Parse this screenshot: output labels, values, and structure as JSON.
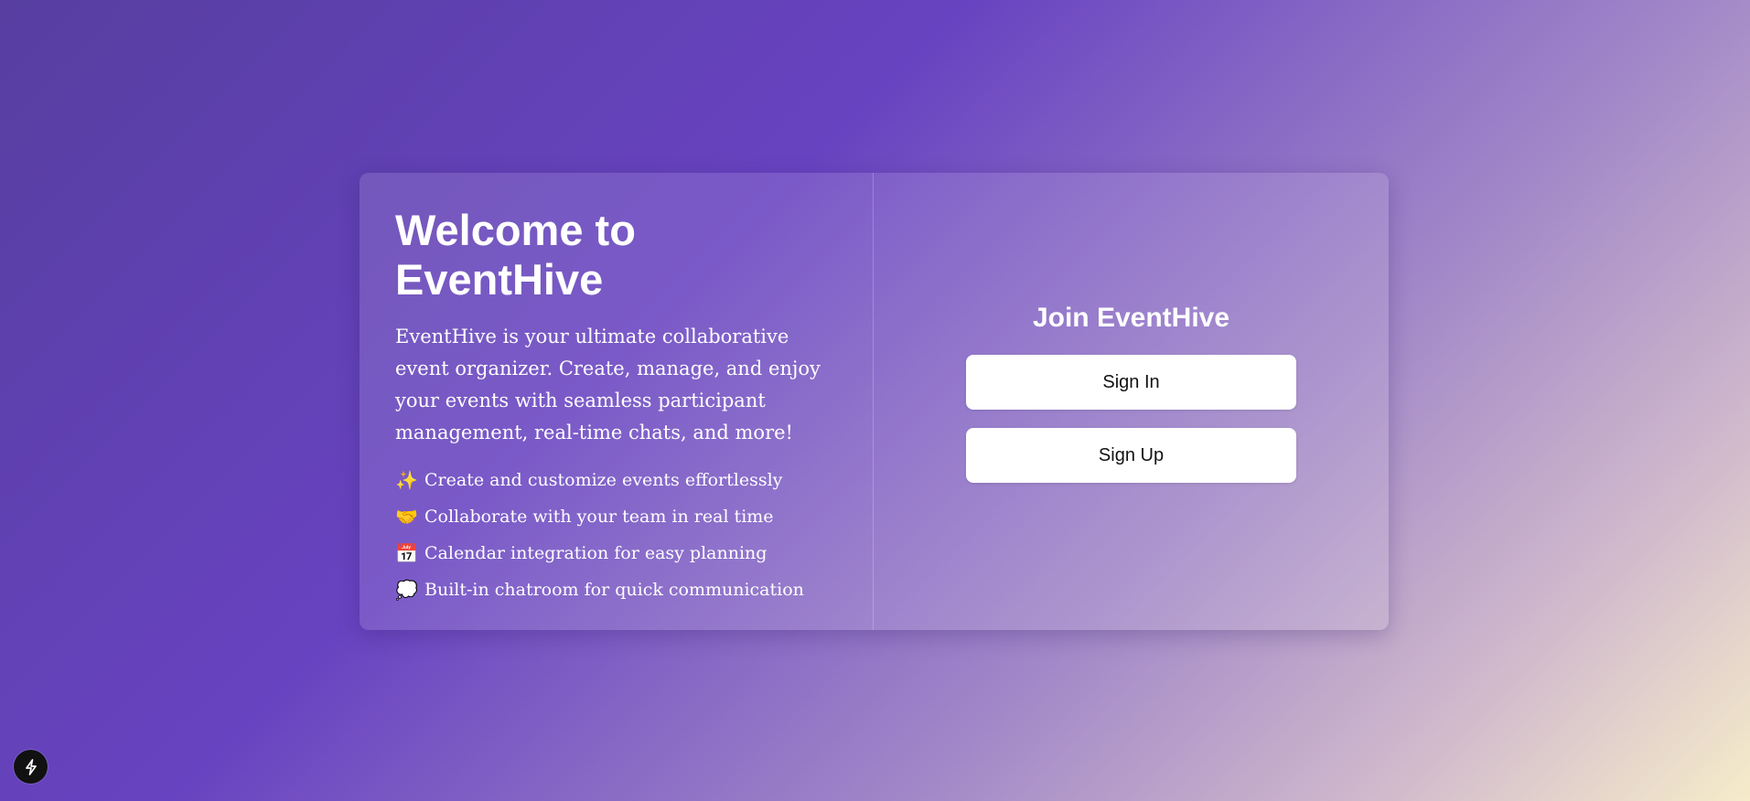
{
  "welcome": {
    "title": "Welcome to EventHive",
    "description": "EventHive is your ultimate collaborative event organizer. Create, manage, and enjoy your events with seamless participant management, real-time chats, and more!",
    "features": [
      {
        "icon": "✨",
        "icon_name": "sparkles-icon",
        "text": "Create and customize events effortlessly"
      },
      {
        "icon": "🤝",
        "icon_name": "handshake-icon",
        "text": "Collaborate with your team in real time"
      },
      {
        "icon": "📅",
        "icon_name": "calendar-icon",
        "text": "Calendar integration for easy planning"
      },
      {
        "icon": "💭",
        "icon_name": "speech-bubble-icon",
        "text": "Built-in chatroom for quick communication"
      }
    ]
  },
  "auth": {
    "title": "Join EventHive",
    "sign_in_label": "Sign In",
    "sign_up_label": "Sign Up"
  },
  "dev_indicator": {
    "icon_name": "lightning-bolt-icon"
  },
  "colors": {
    "background_start": "#573ea0",
    "background_mid": "#6843c1",
    "background_end": "#f6ecca",
    "button_bg": "#ffffff",
    "text": "#ffffff"
  }
}
